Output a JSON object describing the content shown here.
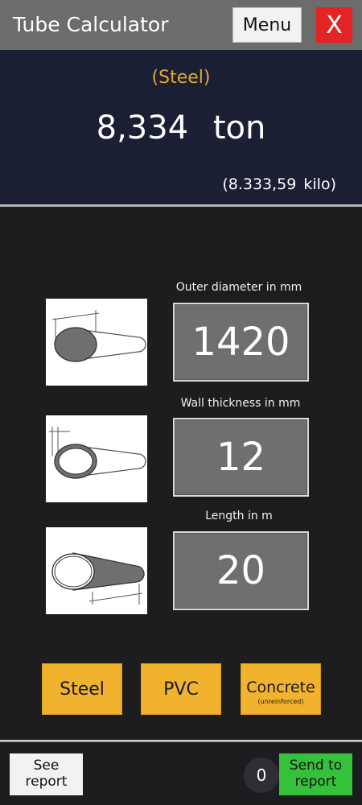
{
  "header": {
    "title": "Tube Calculator",
    "menu_label": "Menu",
    "close_label": "X"
  },
  "result": {
    "material": "(Steel)",
    "weight": "8,334 ton",
    "kilo": "(8.333,59 kilo)"
  },
  "fields": {
    "outer_diameter": {
      "label": "Outer diameter in mm",
      "value": "1420"
    },
    "wall_thickness": {
      "label": "Wall thickness in mm",
      "value": "12"
    },
    "length": {
      "label": "Length in m",
      "value": "20"
    }
  },
  "materials": {
    "steel": "Steel",
    "pvc": "PVC",
    "concrete": "Concrete",
    "concrete_sub": "(unreinforced)"
  },
  "footer": {
    "see_report_line1": "See",
    "see_report_line2": "report",
    "count": "0",
    "send_report_line1": "Send to",
    "send_report_line2": "report"
  },
  "colors": {
    "title_bar": "#6c6c6c",
    "result_bg": "#1b1f33",
    "material_text": "#e4a52e",
    "close_button": "#e42424",
    "material_button": "#f1b32d",
    "send_button": "#35c23a",
    "value_box": "#6f6f6f"
  },
  "icons": {
    "outer_diameter": "tube-outer-diameter-icon",
    "wall_thickness": "tube-wall-thickness-icon",
    "length": "tube-length-icon"
  }
}
